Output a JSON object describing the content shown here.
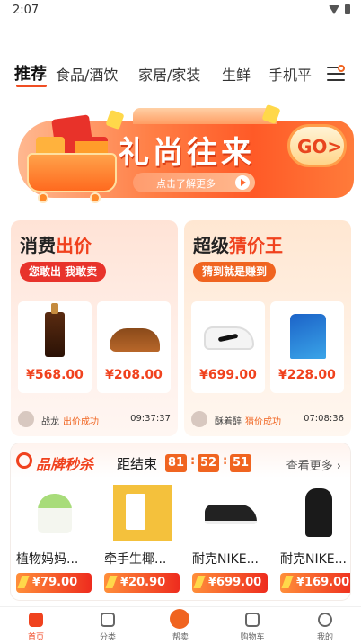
{
  "status_bar": {
    "time": "2:07"
  },
  "tabs": [
    {
      "label": "推荐",
      "active": true
    },
    {
      "label": "食品/酒饮"
    },
    {
      "label": "家居/家装"
    },
    {
      "label": "生鲜"
    },
    {
      "label": "手机平"
    }
  ],
  "banner": {
    "title": "礼尚往来",
    "subtitle": "点击了解更多",
    "go_label": "GO>"
  },
  "consume_card": {
    "title_black": "消费",
    "title_red": "出价",
    "pill": "您敢出 我敢卖",
    "products": [
      {
        "price": "¥568.00",
        "icon": "serum-bottle"
      },
      {
        "price": "¥208.00",
        "icon": "visor-hat"
      }
    ],
    "winner": {
      "name": "战龙",
      "status": "出价成功",
      "time": "09:37:37"
    }
  },
  "guess_card": {
    "title_black": "超级",
    "title_red": "猜价王",
    "pill": "猜到就是赚到",
    "products": [
      {
        "price": "¥699.00",
        "icon": "sneaker"
      },
      {
        "price": "¥228.00",
        "icon": "sport-shirt"
      }
    ],
    "winner": {
      "name": "酥着醉",
      "status": "猜价成功",
      "time": "07:08:36"
    }
  },
  "flash_sale": {
    "brand": "品牌秒杀",
    "countdown_label": "距结束",
    "countdown": [
      "81",
      "52",
      "51"
    ],
    "see_more": "查看更多",
    "items": [
      {
        "name": "植物妈妈...",
        "price": "¥79.00"
      },
      {
        "name": "牵手生椰...",
        "price": "¥20.90"
      },
      {
        "name": "耐克NIKE...",
        "price": "¥699.00"
      },
      {
        "name": "耐克NIKE...",
        "price": "¥169.00"
      }
    ]
  },
  "bottom_nav": [
    {
      "label": "首页",
      "icon": "home-icon",
      "active": true
    },
    {
      "label": "分类",
      "icon": "category-icon"
    },
    {
      "label": "帮卖",
      "icon": "help-sell-icon"
    },
    {
      "label": "购物车",
      "icon": "cart-icon"
    },
    {
      "label": "我的",
      "icon": "profile-icon"
    }
  ],
  "colors": {
    "accent": "#f0421e",
    "orange": "#f06420"
  }
}
